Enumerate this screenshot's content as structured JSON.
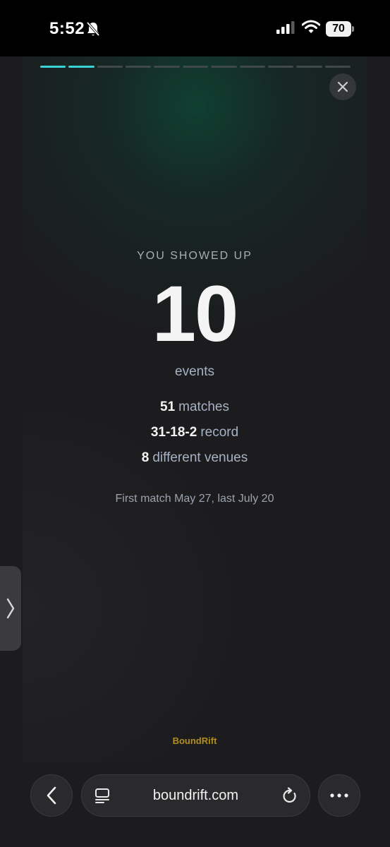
{
  "status_bar": {
    "time": "5:52",
    "battery_level": "70",
    "icons": [
      "bell-slash-icon",
      "cellular-signal-icon",
      "wifi-icon",
      "battery-icon"
    ]
  },
  "story": {
    "progress": {
      "total_segments": 11,
      "active_segments": 2,
      "active_color": "#39d3d6",
      "inactive_color": "#3f4a48"
    },
    "close_icon": "close-icon",
    "heading": "YOU SHOWED UP",
    "big_value": "10",
    "unit": "events",
    "stats": [
      {
        "value": "51",
        "label": "matches"
      },
      {
        "value": "31-18-2",
        "label": "record"
      },
      {
        "value": "8",
        "label": "different venues"
      }
    ],
    "date_range": "First match May 27, last July 20",
    "brand": "BoundRift",
    "brand_color": "#b08e1e"
  },
  "side_tab": {
    "icon": "chevron-right-icon"
  },
  "browser": {
    "url": "boundrift.com",
    "back_icon": "chevron-left-icon",
    "tabs_icon": "tabs-icon",
    "reload_icon": "reload-icon",
    "more_icon": "more-icon"
  }
}
